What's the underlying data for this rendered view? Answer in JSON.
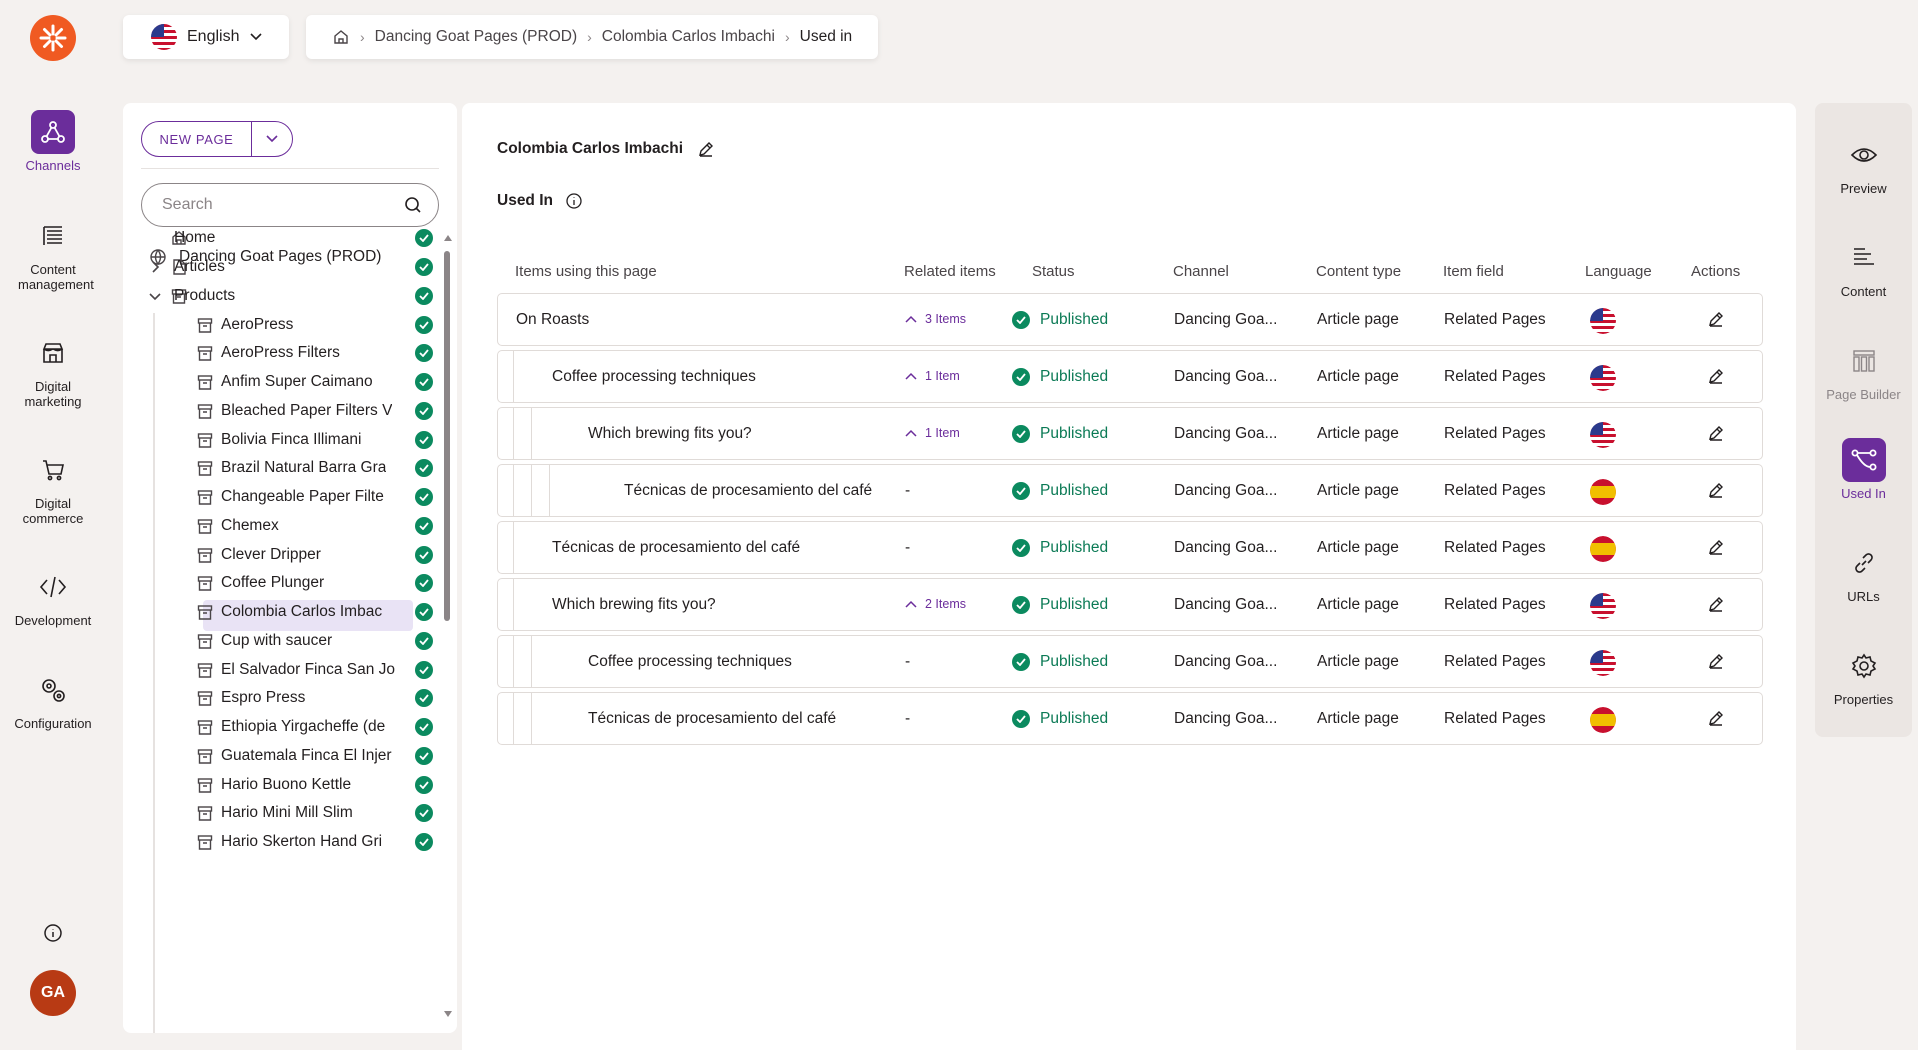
{
  "rail": {
    "items": [
      {
        "label": "Channels",
        "icon": "channels-icon"
      },
      {
        "label": "Content management",
        "icon": "content-management-icon"
      },
      {
        "label": "Digital marketing",
        "icon": "digital-marketing-icon"
      },
      {
        "label": "Digital commerce",
        "icon": "cart-icon"
      },
      {
        "label": "Development",
        "icon": "code-icon"
      },
      {
        "label": "Configuration",
        "icon": "gears-icon"
      }
    ],
    "avatar": "GA"
  },
  "header": {
    "language": "English",
    "breadcrumb": [
      "Dancing Goat Pages (PROD)",
      "Colombia Carlos Imbachi",
      "Used in"
    ]
  },
  "tree": {
    "new_page_label": "NEW PAGE",
    "search_placeholder": "Search",
    "root": "Dancing Goat Pages (PROD)",
    "items": [
      {
        "label": "Home",
        "level": 0,
        "icon": "home-icon"
      },
      {
        "label": "Articles",
        "level": 0,
        "icon": "page-icon",
        "chevron": "right"
      },
      {
        "label": "Products",
        "level": 0,
        "icon": "product-icon",
        "chevron": "down"
      },
      {
        "label": "AeroPress",
        "level": 1
      },
      {
        "label": "AeroPress Filters",
        "level": 1
      },
      {
        "label": "Anfim Super Caimano",
        "level": 1
      },
      {
        "label": "Bleached Paper Filters V",
        "level": 1
      },
      {
        "label": "Bolivia Finca Illimani",
        "level": 1
      },
      {
        "label": "Brazil Natural Barra Gra",
        "level": 1
      },
      {
        "label": "Changeable Paper Filte",
        "level": 1
      },
      {
        "label": "Chemex",
        "level": 1
      },
      {
        "label": "Clever Dripper",
        "level": 1
      },
      {
        "label": "Coffee Plunger",
        "level": 1
      },
      {
        "label": "Colombia Carlos Imbac",
        "level": 1,
        "selected": true
      },
      {
        "label": "Cup with saucer",
        "level": 1
      },
      {
        "label": "El Salvador Finca San Jo",
        "level": 1
      },
      {
        "label": "Espro Press",
        "level": 1
      },
      {
        "label": "Ethiopia Yirgacheffe (de",
        "level": 1
      },
      {
        "label": "Guatemala Finca El Injer",
        "level": 1
      },
      {
        "label": "Hario Buono Kettle",
        "level": 1
      },
      {
        "label": "Hario Mini Mill Slim",
        "level": 1
      },
      {
        "label": "Hario Skerton Hand Gri",
        "level": 1
      }
    ]
  },
  "main": {
    "title": "Colombia Carlos Imbachi",
    "section_title": "Used In",
    "columns": [
      "Items using this page",
      "Related items",
      "Status",
      "Channel",
      "Content type",
      "Item field",
      "Language",
      "Actions"
    ],
    "rows": [
      {
        "name": "On Roasts",
        "depth": 0,
        "related": "3 Items",
        "status": "Published",
        "channel": "Dancing Goa...",
        "type": "Article page",
        "field": "Related Pages",
        "lang": "us"
      },
      {
        "name": "Coffee processing techniques",
        "depth": 1,
        "related": "1 Item",
        "status": "Published",
        "channel": "Dancing Goa...",
        "type": "Article page",
        "field": "Related Pages",
        "lang": "us"
      },
      {
        "name": "Which brewing fits you?",
        "depth": 2,
        "related": "1 Item",
        "status": "Published",
        "channel": "Dancing Goa...",
        "type": "Article page",
        "field": "Related Pages",
        "lang": "us"
      },
      {
        "name": "Técnicas de procesamiento del café",
        "depth": 3,
        "related": "-",
        "status": "Published",
        "channel": "Dancing Goa...",
        "type": "Article page",
        "field": "Related Pages",
        "lang": "es"
      },
      {
        "name": "Técnicas de procesamiento del café",
        "depth": 1,
        "related": "-",
        "status": "Published",
        "channel": "Dancing Goa...",
        "type": "Article page",
        "field": "Related Pages",
        "lang": "es"
      },
      {
        "name": "Which brewing fits you?",
        "depth": 1,
        "related": "2 Items",
        "status": "Published",
        "channel": "Dancing Goa...",
        "type": "Article page",
        "field": "Related Pages",
        "lang": "us"
      },
      {
        "name": "Coffee processing techniques",
        "depth": 2,
        "related": "-",
        "status": "Published",
        "channel": "Dancing Goa...",
        "type": "Article page",
        "field": "Related Pages",
        "lang": "us"
      },
      {
        "name": "Técnicas de procesamiento del café",
        "depth": 2,
        "related": "-",
        "status": "Published",
        "channel": "Dancing Goa...",
        "type": "Article page",
        "field": "Related Pages",
        "lang": "es"
      }
    ]
  },
  "right_rail": {
    "items": [
      {
        "label": "Preview",
        "icon": "eye-icon"
      },
      {
        "label": "Content",
        "icon": "content-lines-icon"
      },
      {
        "label": "Page Builder",
        "icon": "page-builder-icon",
        "disabled": true
      },
      {
        "label": "Used In",
        "icon": "used-in-icon",
        "active": true
      },
      {
        "label": "URLs",
        "icon": "link-icon"
      },
      {
        "label": "Properties",
        "icon": "gear-icon"
      }
    ]
  },
  "colors": {
    "accent": "#6b2d9b",
    "success": "#0b8a5f",
    "brand": "#f05a22",
    "background": "#f4f1ef"
  }
}
